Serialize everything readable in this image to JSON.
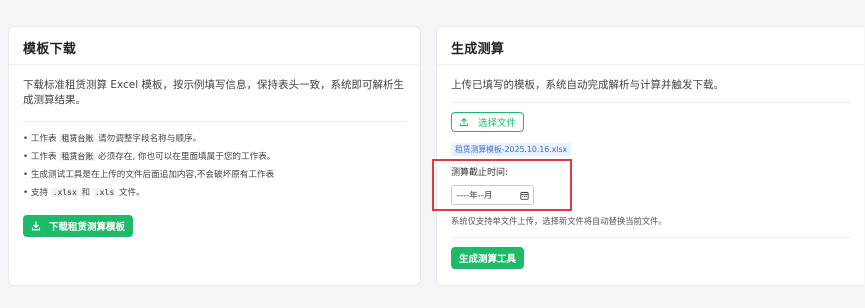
{
  "template_card": {
    "title": "模板下载",
    "description": "下载标准租赁测算 Excel 模板，按示例填写信息，保持表头一致，系统即可解析生成测算结果。",
    "bullets": [
      {
        "a": "工作表 ",
        "code": "租赁台账",
        "b": " 请勿调整字段名称与顺序。"
      },
      {
        "a": "工作表 ",
        "code": "租赁台账",
        "b": " 必须存在, 你也可以在里面填属于您的工作表。"
      },
      {
        "a": "生成测试工具是在上传的文件后面追加内容,不会破坏原有工作表",
        "code": "",
        "b": ""
      },
      {
        "a": "支持 ",
        "code": ".xlsx",
        "mid": " 和 ",
        "code2": ".xls",
        "b": " 文件。"
      }
    ],
    "download_button": "下载租赁测算模板",
    "download_icon": "download-icon"
  },
  "generate_card": {
    "title": "生成测算",
    "description": "上传已填写的模板，系统自动完成解析与计算并触发下载。",
    "choose_file_button": "选择文件",
    "choose_file_icon": "upload-icon",
    "selected_file": "租赁测算模板-2025.10.16.xlsx",
    "cutoff_label": "测算截止时间:",
    "month_input": {
      "value": "----年--月",
      "icon": "calendar-icon"
    },
    "note": "系统仅支持单文件上传，选择新文件将自动替换当前文件。",
    "generate_button": "生成测算工具"
  },
  "colors": {
    "primary": "#1fb96a",
    "highlight": "#e0393e",
    "file_tag_bg": "#eaf1fe",
    "file_tag_text": "#3b6fd8"
  }
}
